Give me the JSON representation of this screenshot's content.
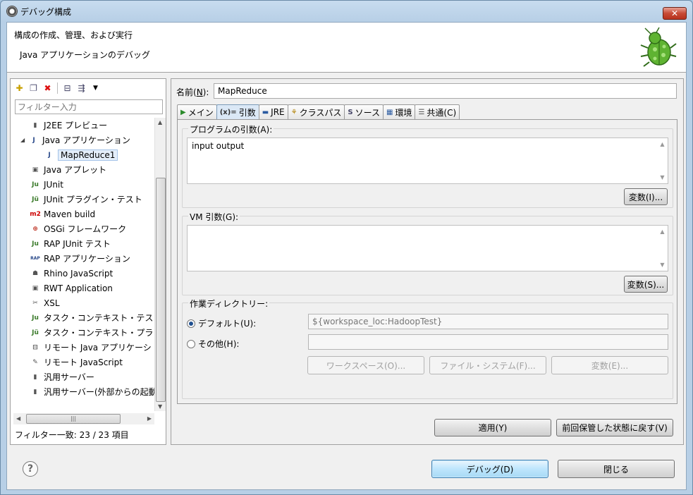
{
  "window": {
    "title": "デバッグ構成",
    "close": "✕"
  },
  "header": {
    "title": "構成の作成、管理、および実行",
    "subtitle": "Java アプリケーションのデバッグ"
  },
  "left": {
    "filter_placeholder": "フィルター入力",
    "tree": [
      {
        "label": "J2EE プレビュー",
        "icon": "▮",
        "type": "item"
      },
      {
        "label": "Java アプリケーション",
        "icon": "J",
        "type": "expanded"
      },
      {
        "label": "MapReduce1",
        "icon": "J",
        "type": "child"
      },
      {
        "label": "Java アプレット",
        "icon": "▣",
        "type": "item"
      },
      {
        "label": "JUnit",
        "icon": "Ju",
        "type": "item"
      },
      {
        "label": "JUnit プラグイン・テスト",
        "icon": "Jü",
        "type": "item"
      },
      {
        "label": "Maven build",
        "icon": "m2",
        "type": "item"
      },
      {
        "label": "OSGi フレームワーク",
        "icon": "⊕",
        "type": "item"
      },
      {
        "label": "RAP JUnit テスト",
        "icon": "Ju",
        "type": "item"
      },
      {
        "label": "RAP アプリケーション",
        "icon": "RAP",
        "type": "item"
      },
      {
        "label": "Rhino JavaScript",
        "icon": "☗",
        "type": "item"
      },
      {
        "label": "RWT Application",
        "icon": "▣",
        "type": "item"
      },
      {
        "label": "XSL",
        "icon": "✂",
        "type": "item"
      },
      {
        "label": "タスク・コンテキスト・テス",
        "icon": "Ju",
        "type": "item"
      },
      {
        "label": "タスク・コンテキスト・プラ",
        "icon": "Jü",
        "type": "item"
      },
      {
        "label": "リモート Java アプリケーシ",
        "icon": "⊟",
        "type": "item"
      },
      {
        "label": "リモート JavaScript",
        "icon": "✎",
        "type": "item"
      },
      {
        "label": "汎用サーバー",
        "icon": "▮",
        "type": "item"
      },
      {
        "label": "汎用サーバー(外部からの起動",
        "icon": "▮",
        "type": "item"
      }
    ],
    "filter_status": "フィルター一致: 23 / 23 項目"
  },
  "right": {
    "name_label": "名前(",
    "name_mn": "N",
    "name_label_end": "):",
    "name_value": "MapReduce",
    "tabs": [
      {
        "label": "メイン",
        "icon": "▶"
      },
      {
        "label": "引数",
        "icon": "(x)="
      },
      {
        "label": "JRE",
        "icon": "▬"
      },
      {
        "label": "クラスパス",
        "icon": "⚘"
      },
      {
        "label": "ソース",
        "icon": "S"
      },
      {
        "label": "環境",
        "icon": "▦"
      },
      {
        "label": "共通(C)",
        "icon": "☰"
      }
    ],
    "program_args": {
      "legend": "プログラムの引数(A):",
      "value": "input output",
      "vars_button": "変数(I)..."
    },
    "vm_args": {
      "legend": "VM 引数(G):",
      "value": "",
      "vars_button": "変数(S)..."
    },
    "workdir": {
      "legend": "作業ディレクトリー:",
      "default_label": "デフォルト(U):",
      "default_value": "${workspace_loc:HadoopTest}",
      "other_label": "その他(H):",
      "other_value": "",
      "workspace_button": "ワークスペース(O)...",
      "filesystem_button": "ファイル・システム(F)...",
      "vars_button": "変数(E)..."
    },
    "apply_button": "適用(Y)",
    "revert_button": "前回保管した状態に戻す(V)"
  },
  "footer": {
    "help": "?",
    "debug_button": "デバッグ(D)",
    "close_button": "閉じる"
  }
}
